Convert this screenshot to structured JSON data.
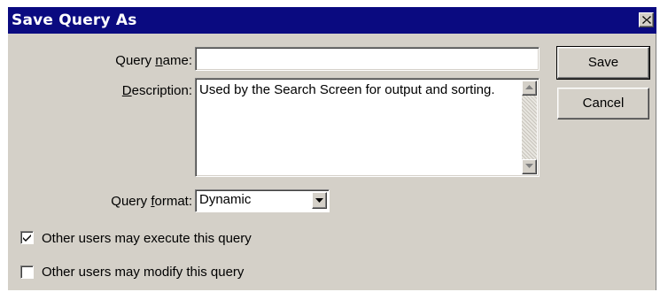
{
  "dialog": {
    "title": "Save Query As",
    "close_glyph": "✕"
  },
  "fields": {
    "query_name": {
      "label_pre": "Query ",
      "label_acc": "n",
      "label_post": "ame:",
      "value": ""
    },
    "description": {
      "label_pre": "",
      "label_acc": "D",
      "label_post": "escription:",
      "value": "Used by the Search Screen for output and sorting."
    },
    "query_format": {
      "label_pre": "Query ",
      "label_acc": "f",
      "label_post": "ormat:",
      "value": "Dynamic"
    }
  },
  "buttons": {
    "save": "Save",
    "cancel": "Cancel"
  },
  "checkboxes": {
    "execute": {
      "label": "Other users may execute this query",
      "checked": true
    },
    "modify": {
      "label": "Other users may modify this query",
      "checked": false
    }
  },
  "icons": {
    "close": "close-icon",
    "scroll_up": "arrow-up-icon",
    "scroll_down": "arrow-down-icon",
    "dropdown": "chevron-down-icon",
    "check": "checkmark-icon"
  },
  "colors": {
    "titlebar": "#0a0a80",
    "face": "#d4d0c8"
  }
}
